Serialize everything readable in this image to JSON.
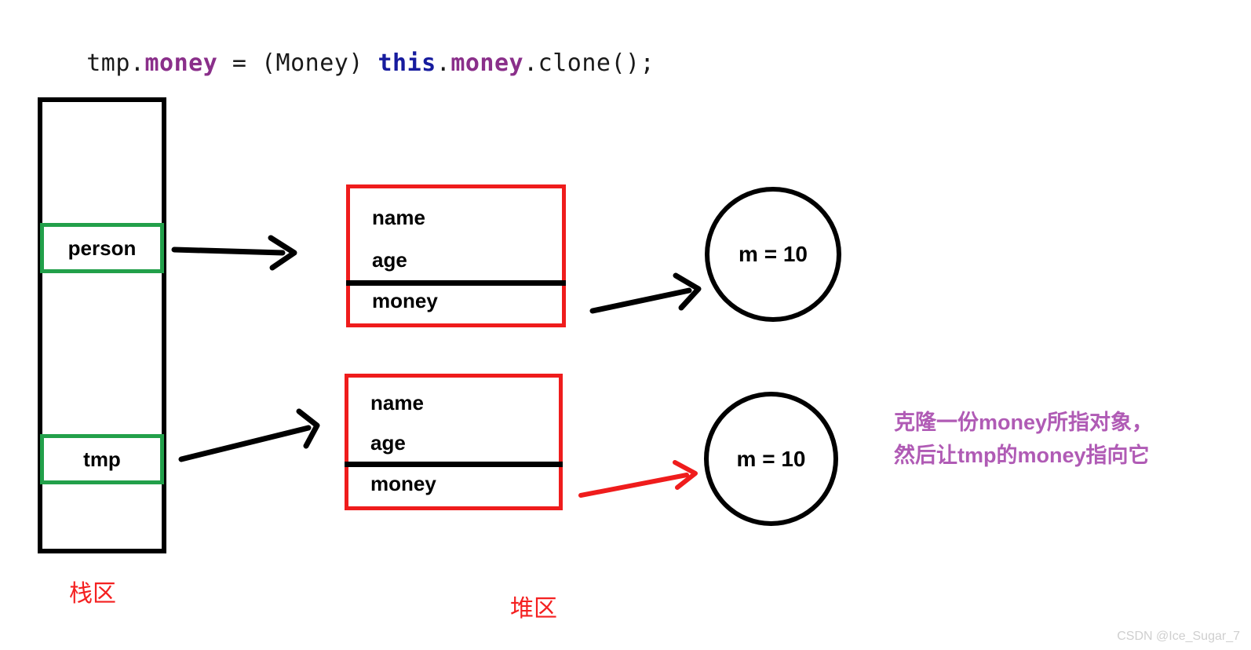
{
  "code": {
    "tokens": [
      {
        "t": "tmp.",
        "k": "plain"
      },
      {
        "t": "money",
        "k": "field"
      },
      {
        "t": " = (Money) ",
        "k": "plain"
      },
      {
        "t": "this",
        "k": "kw"
      },
      {
        "t": ".",
        "k": "plain"
      },
      {
        "t": "money",
        "k": "field"
      },
      {
        "t": ".clone();",
        "k": "plain"
      }
    ],
    "full_text": "tmp.money = (Money) this.money.clone();"
  },
  "stack": {
    "region_label": "栈区",
    "slots": [
      {
        "label": "person"
      },
      {
        "label": "tmp"
      }
    ],
    "border_color": "#000000",
    "slot_border_color": "#22a04a"
  },
  "heap": {
    "region_label": "堆区",
    "objects": [
      {
        "name": "person-object",
        "fields": [
          "name",
          "age",
          "money"
        ],
        "border_color": "#ef1c1c"
      },
      {
        "name": "tmp-object",
        "fields": [
          "name",
          "age",
          "money"
        ],
        "border_color": "#ef1c1c"
      }
    ],
    "money_objects": [
      {
        "label": "m = 10"
      },
      {
        "label": "m = 10"
      }
    ]
  },
  "arrows": [
    {
      "name": "person-to-object",
      "color": "#000000"
    },
    {
      "name": "tmp-to-object",
      "color": "#000000"
    },
    {
      "name": "object1-money-to-circle1",
      "color": "#000000"
    },
    {
      "name": "object2-money-to-circle2",
      "color": "#ef1c1c"
    }
  ],
  "annotation": {
    "color": "#b05bb5",
    "lines": [
      "克隆一份money所指对象，",
      "然后让tmp的money指向它"
    ]
  },
  "watermark": {
    "text": "CSDN @Ice_Sugar_7"
  }
}
